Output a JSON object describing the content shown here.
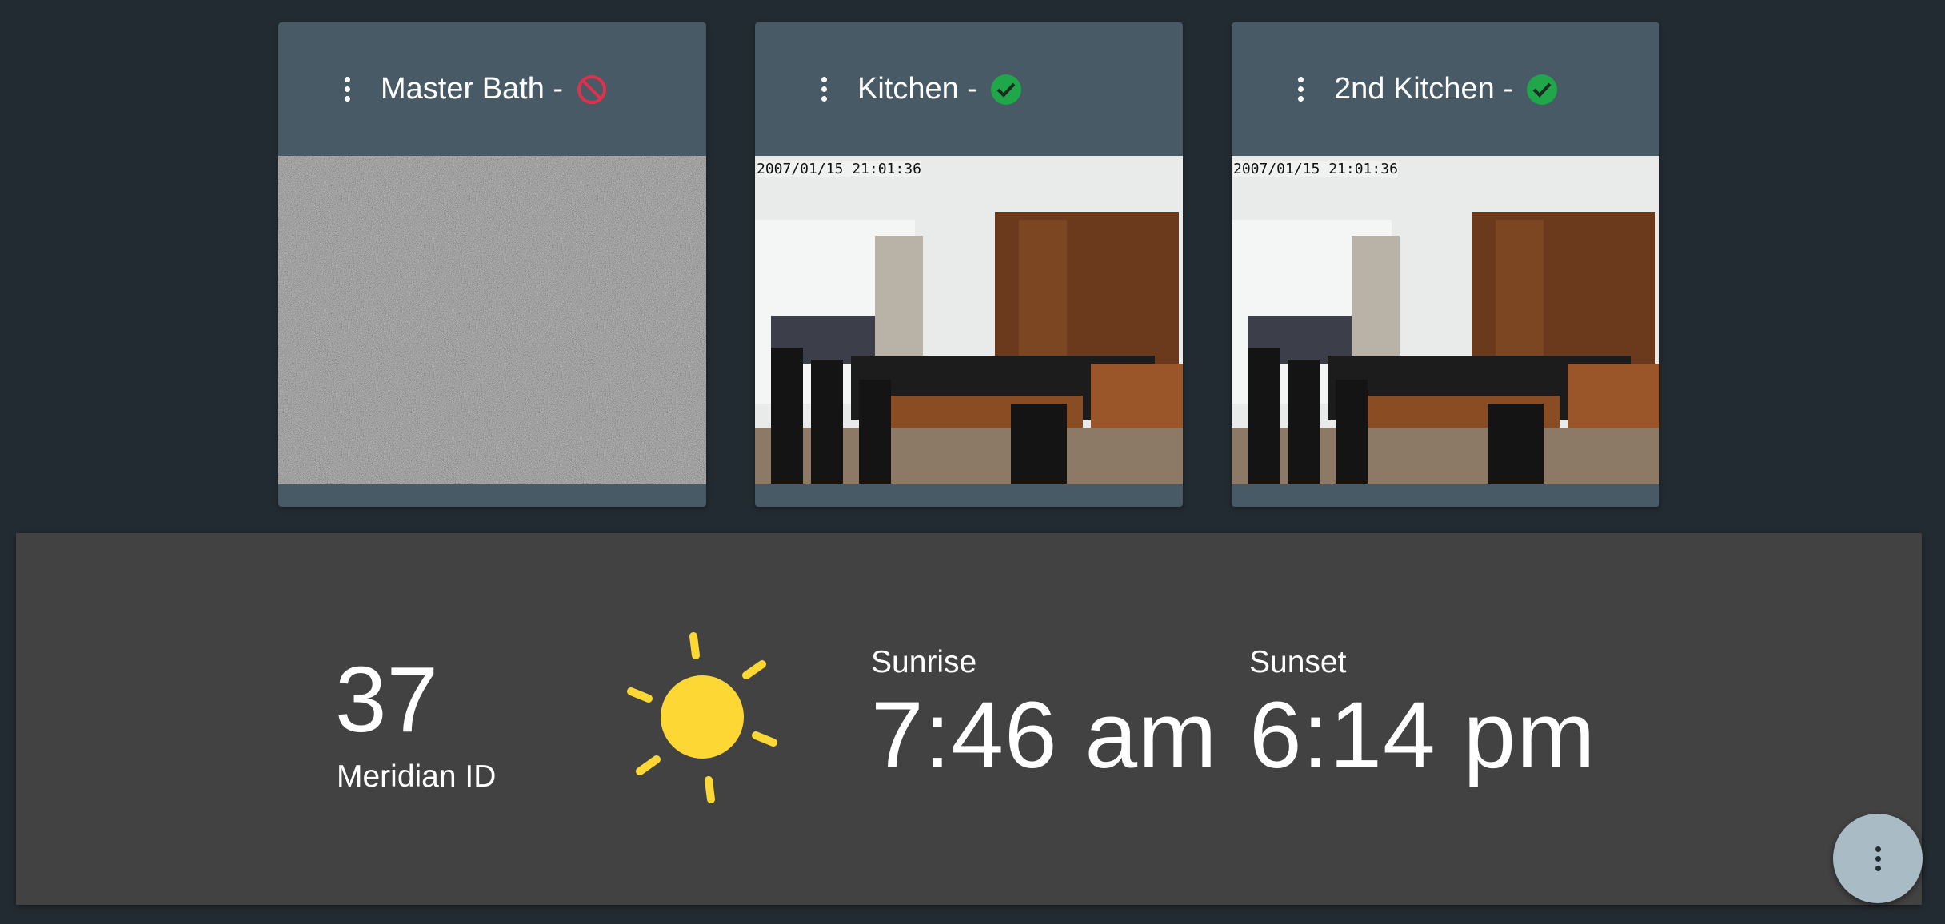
{
  "cameras": [
    {
      "name": "Master Bath -",
      "status": "offline",
      "status_icon": "block-icon",
      "status_color": "#e0314c",
      "timestamp": ""
    },
    {
      "name": "Kitchen -",
      "status": "online",
      "status_icon": "check-circle-icon",
      "status_color": "#1fa74a",
      "timestamp": "2007/01/15 21:01:36"
    },
    {
      "name": "2nd Kitchen -",
      "status": "online",
      "status_icon": "check-circle-icon",
      "status_color": "#1fa74a",
      "timestamp": "2007/01/15 21:01:36"
    }
  ],
  "weather": {
    "temperature": "37",
    "label": "Meridian ID",
    "icon": "sun-icon",
    "icon_color": "#fdd835",
    "sunrise_label": "Sunrise",
    "sunrise_time": "7:46 am",
    "sunset_label": "Sunset",
    "sunset_time": "6:14 pm"
  },
  "fab": {
    "icon": "more-vert-icon"
  },
  "colors": {
    "background": "#222b31",
    "card": "#475a66",
    "weather_card": "#424242",
    "fab": "#a9bcc6"
  }
}
